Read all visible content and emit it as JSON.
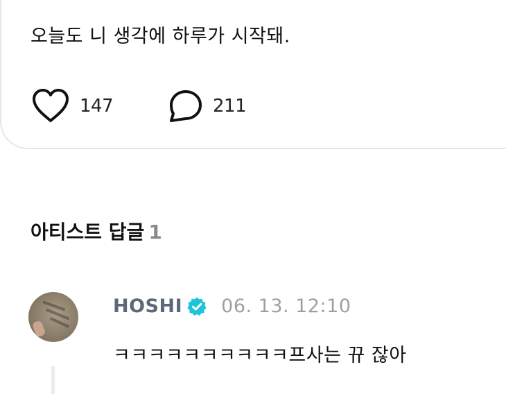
{
  "post": {
    "text": "오늘도 니 생각에 하루가 시작돼.",
    "like_count": "147",
    "comment_count": "211"
  },
  "artist_replies": {
    "title": "아티스트 답글",
    "count": "1"
  },
  "reply": {
    "author": "HOSHI",
    "timestamp": "06. 13. 12:10",
    "text": "ㅋㅋㅋㅋㅋㅋㅋㅋㅋㅋ프사는 뀨 잖아"
  },
  "colors": {
    "verified_badge": "#1ec4d8",
    "author_name": "#5d6878",
    "timestamp": "#9aa0a6",
    "count_muted": "#8a8a8a"
  },
  "icons": {
    "like": "heart-outline-icon",
    "comment": "speech-bubble-icon",
    "verified": "verified-badge-icon"
  }
}
